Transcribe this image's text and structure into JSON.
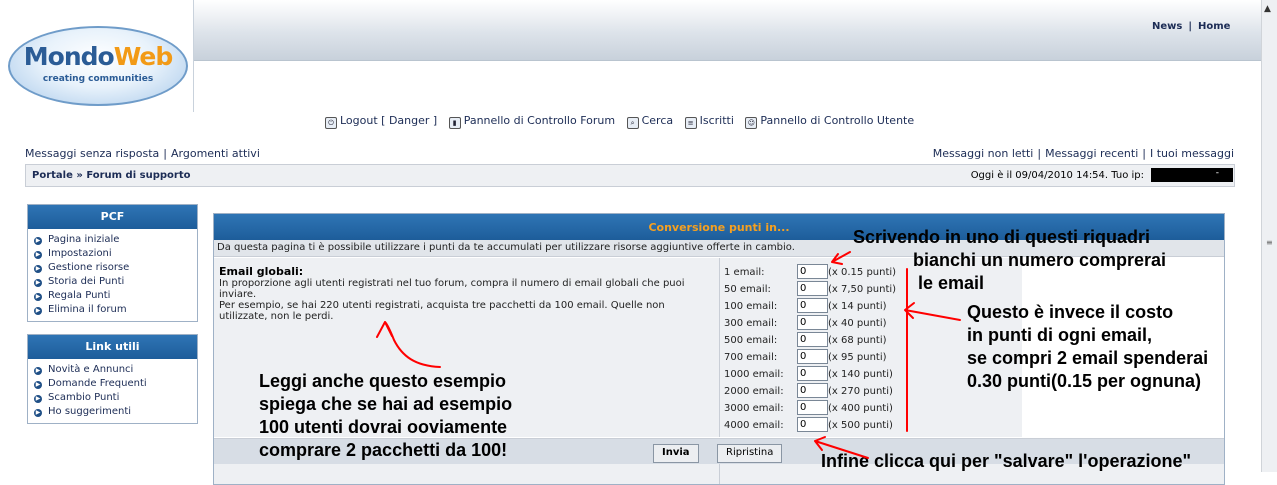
{
  "header": {
    "logo": {
      "brand_part1": "Mondo",
      "brand_part2": "Web",
      "tagline": "creating  communities"
    },
    "top_links": [
      "News",
      "Home"
    ]
  },
  "main_menu": {
    "logout": "Logout [ Danger ]",
    "forum_control": "Pannello di Controllo Forum",
    "search": "Cerca",
    "members": "Iscritti",
    "user_control": "Pannello di Controllo Utente"
  },
  "links_left": [
    "Messaggi senza risposta",
    "Argomenti attivi"
  ],
  "links_right": [
    "Messaggi non letti",
    "Messaggi recenti",
    "I tuoi messaggi"
  ],
  "breadcrumb": {
    "portal": "Portale",
    "separator": "»",
    "forum": "Forum di supporto"
  },
  "date_info": "Oggi è il 09/04/2010 14:54. Tuo ip:",
  "ip_mask": "-",
  "sidebar": {
    "pcf": {
      "title": "PCF",
      "items": [
        "Pagina iniziale",
        "Impostazioni",
        "Gestione risorse",
        "Storia dei Punti",
        "Regala Punti",
        "Elimina il forum"
      ]
    },
    "links": {
      "title": "Link utili",
      "items": [
        "Novità e Annunci",
        "Domande Frequenti",
        "Scambio Punti",
        "Ho suggerimenti"
      ]
    }
  },
  "conversion": {
    "title": "Conversione punti in...",
    "intro": "Da questa pagina ti è possibile utilizzare i punti da te accumulati per utilizzare risorse aggiuntive offerte in cambio.",
    "email_title": "Email globali:",
    "email_desc": [
      "In proporzione agli utenti registrati nel tuo forum, compra il numero di email globali che puoi inviare.",
      "Per esempio, se hai 220 utenti registrati, acquista tre pacchetti da 100 email. Quelle non utilizzate, non le perdi."
    ],
    "options": [
      {
        "label": "1 email:",
        "value": "0",
        "cost": "(x 0.15 punti)"
      },
      {
        "label": "50 email:",
        "value": "0",
        "cost": "(x 7,50 punti)"
      },
      {
        "label": "100 email:",
        "value": "0",
        "cost": "(x 14 punti)"
      },
      {
        "label": "300 email:",
        "value": "0",
        "cost": "(x 40 punti)"
      },
      {
        "label": "500 email:",
        "value": "0",
        "cost": "(x 68 punti)"
      },
      {
        "label": "700 email:",
        "value": "0",
        "cost": "(x 95 punti)"
      },
      {
        "label": "1000 email:",
        "value": "0",
        "cost": "(x 140 punti)"
      },
      {
        "label": "2000 email:",
        "value": "0",
        "cost": "(x 270 punti)"
      },
      {
        "label": "3000 email:",
        "value": "0",
        "cost": "(x 400 punti)"
      },
      {
        "label": "4000 email:",
        "value": "0",
        "cost": "(x 500 punti)"
      }
    ],
    "submit": "Invia",
    "reset": "Ripristina"
  },
  "annotations": {
    "boxes": [
      "Scrivendo in uno di questi riquadri",
      "bianchi un numero comprerai",
      "le email"
    ],
    "cost": [
      "Questo è invece il costo",
      "in punti di ogni email,",
      "se compri 2 email spenderai",
      "0.30 punti(0.15 per ognuna)"
    ],
    "example": [
      "Leggi anche questo esempio",
      "spiega che se hai ad esempio",
      "100 utenti dovrai ooviamente",
      "comprare 2 pacchetti da 100!"
    ],
    "save": "Infine clicca qui per \"salvare\" l'operazione\""
  },
  "colors": {
    "panel_header": "#1d5d9a",
    "title_accent": "#f5a020",
    "link": "#1c2c55",
    "annotation_arrow": "#ff0000"
  }
}
